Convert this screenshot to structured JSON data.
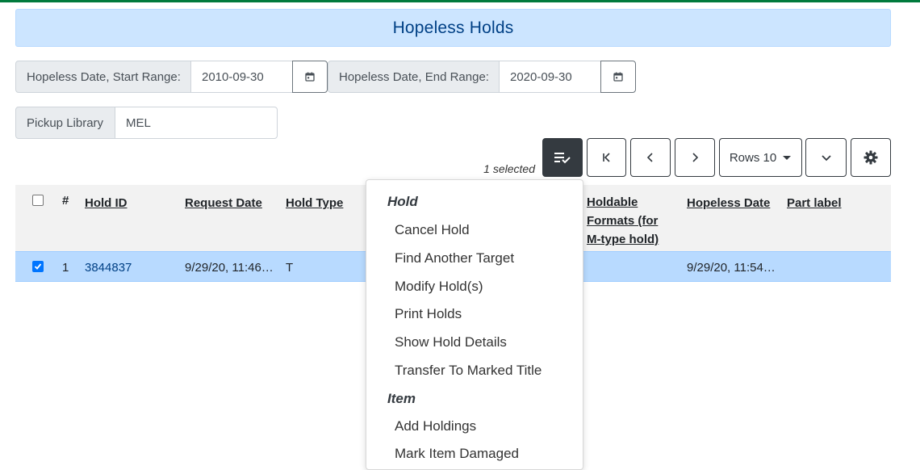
{
  "title": "Hopeless Holds",
  "filters": {
    "start_label": "Hopeless Date, Start Range:",
    "start_value": "2010-09-30",
    "end_label": "Hopeless Date, End Range:",
    "end_value": "2020-09-30",
    "pickup_label": "Pickup Library",
    "pickup_value": "MEL"
  },
  "grid": {
    "selected_text": "1 selected",
    "rows_label": "Rows 10",
    "columns": [
      "#",
      "Hold ID",
      "Request Date",
      "Hold Type",
      "Holdable Formats (for M-type hold)",
      "Hopeless Date",
      "Part label"
    ],
    "rows": [
      {
        "index": "1",
        "hold_id": "3844837",
        "request_date": "9/29/20, 11:46…",
        "hold_type": "T",
        "hopeless_date": "9/29/20, 11:54…",
        "selected": true
      }
    ]
  },
  "menu": {
    "group1": "Hold",
    "hold_items": [
      "Cancel Hold",
      "Find Another Target",
      "Modify Hold(s)",
      "Print Holds",
      "Show Hold Details",
      "Transfer To Marked Title"
    ],
    "group2": "Item",
    "item_items": [
      "Add Holdings",
      "Mark Item Damaged"
    ]
  },
  "colors": {
    "accent_bar": "#007a3d",
    "banner": "#cce5ff",
    "selected_row": "#b8daff"
  }
}
